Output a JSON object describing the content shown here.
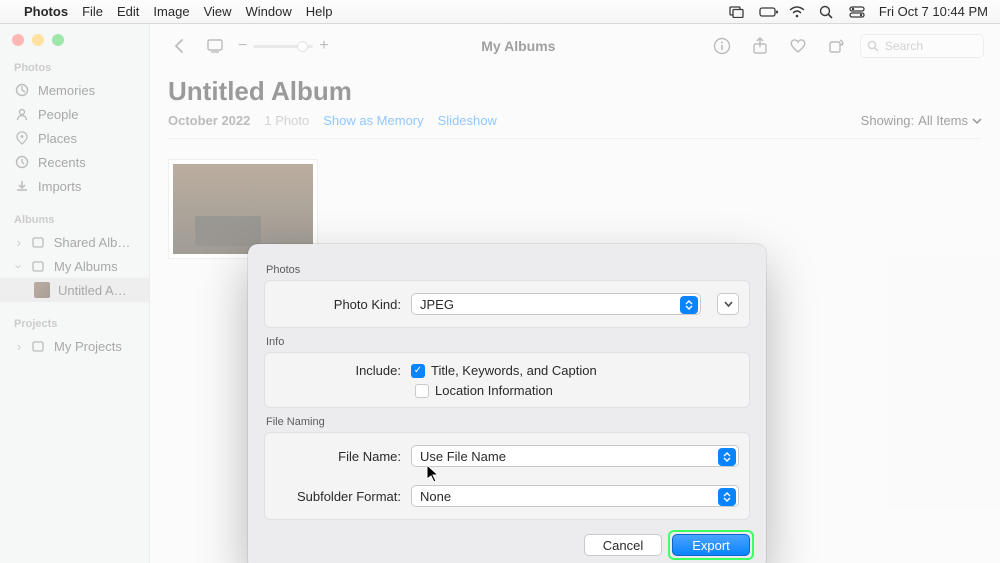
{
  "menubar": {
    "app": "Photos",
    "items": [
      "File",
      "Edit",
      "Image",
      "View",
      "Window",
      "Help"
    ],
    "clock": "Fri Oct 7  10:44 PM"
  },
  "toolbar": {
    "title": "My Albums",
    "search_placeholder": "Search"
  },
  "sidebar": {
    "sections": {
      "photos": {
        "header": "Photos",
        "items": [
          "Memories",
          "People",
          "Places",
          "Recents",
          "Imports"
        ]
      },
      "albums": {
        "header": "Albums",
        "shared": "Shared Albu…",
        "my_albums": "My Albums",
        "selected": "Untitled A…"
      },
      "projects": {
        "header": "Projects",
        "item": "My Projects"
      }
    }
  },
  "album": {
    "title": "Untitled Album",
    "date": "October 2022",
    "count": "1 Photo",
    "show_as_memory": "Show as Memory",
    "slideshow": "Slideshow",
    "showing_label": "Showing:",
    "showing_value": "All Items"
  },
  "dialog": {
    "photos_label": "Photos",
    "photo_kind_label": "Photo Kind:",
    "photo_kind_value": "JPEG",
    "info_label": "Info",
    "include_label": "Include:",
    "include_title": "Title, Keywords, and Caption",
    "include_location": "Location Information",
    "file_naming_label": "File Naming",
    "file_name_label": "File Name:",
    "file_name_value": "Use File Name",
    "subfolder_label": "Subfolder Format:",
    "subfolder_value": "None",
    "cancel": "Cancel",
    "export": "Export"
  }
}
